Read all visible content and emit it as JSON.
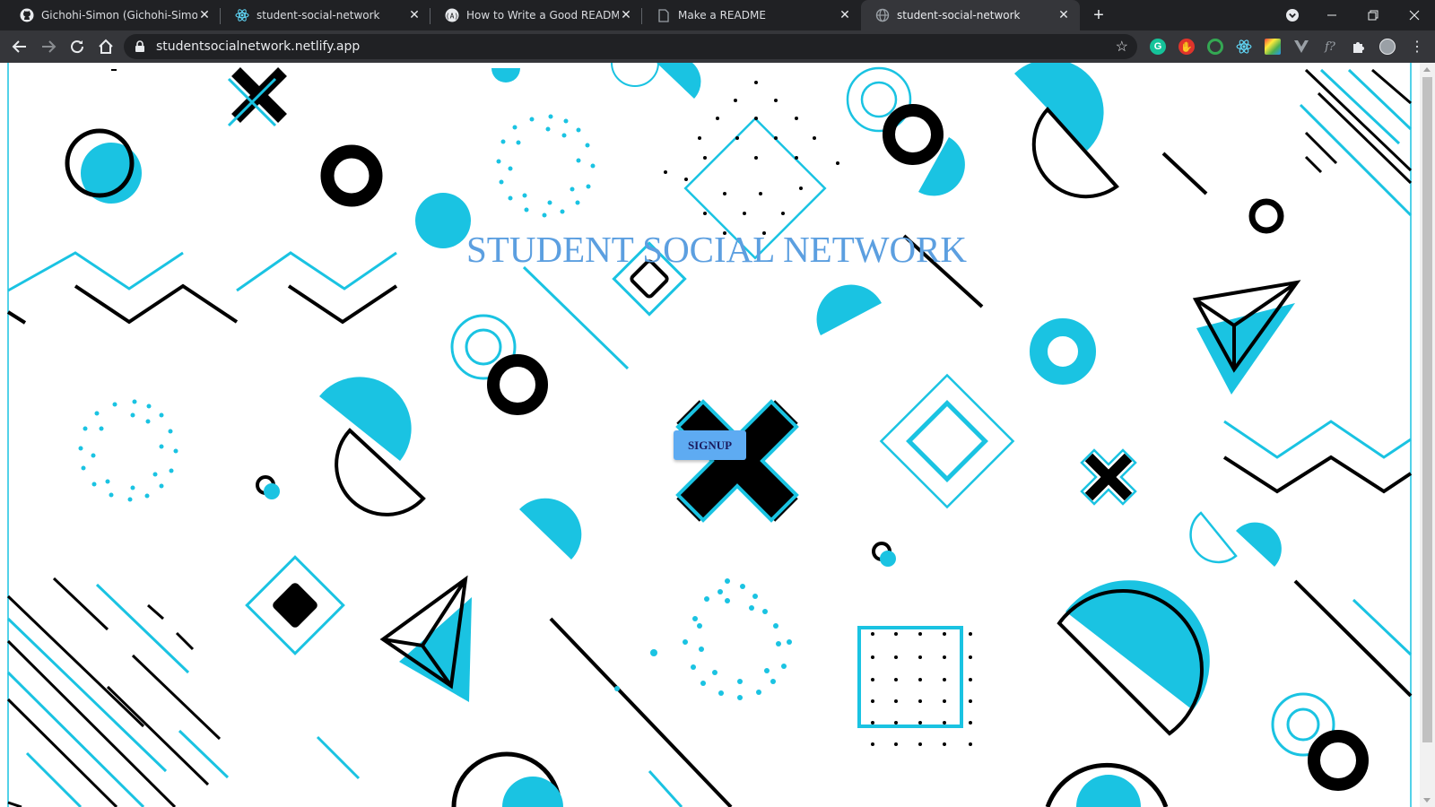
{
  "browser": {
    "tabs": [
      {
        "title": "Gichohi-Simon (Gichohi-Simon)",
        "icon": "github-icon",
        "active": false
      },
      {
        "title": "student-social-network",
        "icon": "react-icon",
        "active": false
      },
      {
        "title": "How to Write a Good README Fi",
        "icon": "freecodecamp-icon",
        "active": false
      },
      {
        "title": "Make a README",
        "icon": "page-icon",
        "active": false
      },
      {
        "title": "student-social-network",
        "icon": "globe-icon",
        "active": true
      }
    ],
    "url": "studentsocialnetwork.netlify.app",
    "extensions": [
      "grammarly-icon",
      "adblock-icon",
      "circle-extension-icon",
      "react-devtools-icon",
      "color-extension-icon",
      "vue-devtools-icon",
      "formula-icon",
      "puzzle-icon",
      "profile-avatar-icon"
    ]
  },
  "page": {
    "heading": "STUDENT SOCIAL NETWORK",
    "signup_label": "SIGNUP"
  },
  "colors": {
    "accent": "#1ac3e2",
    "heading": "#5c9fe0",
    "button": "#5eabf2",
    "button_text": "#1b1b5e",
    "chrome_dark": "#202124",
    "chrome_toolbar": "#35363a"
  }
}
